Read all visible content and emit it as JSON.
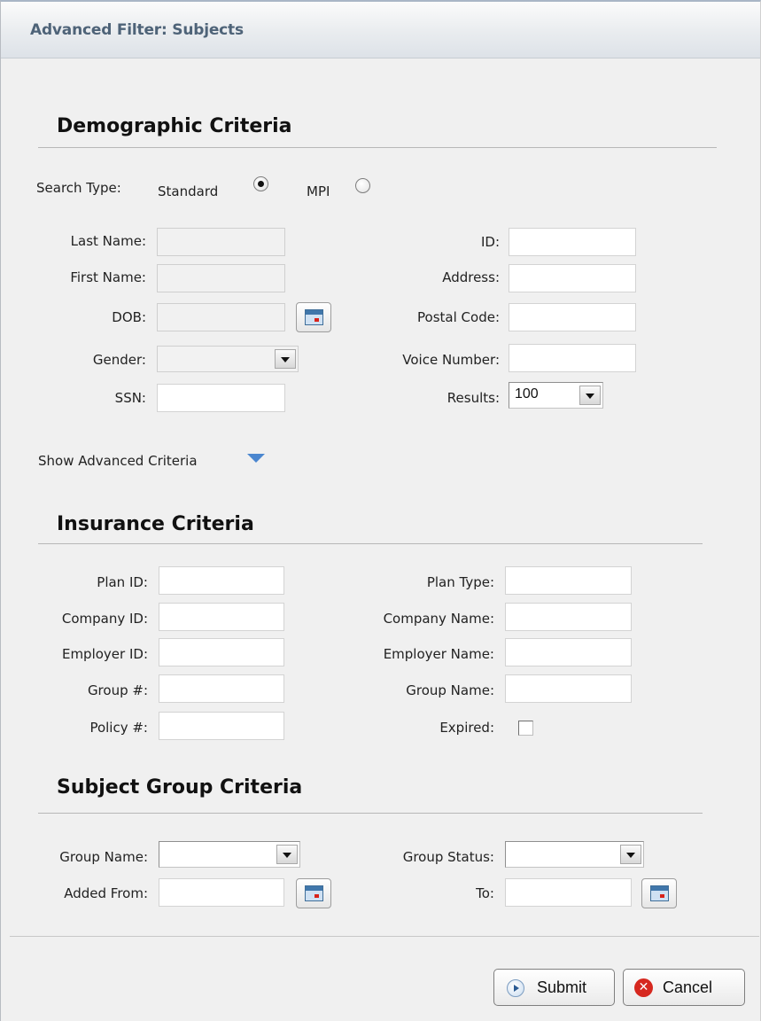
{
  "dialog": {
    "title": "Advanced Filter: Subjects"
  },
  "demographic": {
    "heading": "Demographic Criteria",
    "search_type_label": "Search Type:",
    "standard_label": "Standard",
    "mpi_label": "MPI",
    "last_name_label": "Last Name:",
    "first_name_label": "First Name:",
    "dob_label": "DOB:",
    "gender_label": "Gender:",
    "ssn_label": "SSN:",
    "id_label": "ID:",
    "address_label": "Address:",
    "postal_code_label": "Postal Code:",
    "voice_number_label": "Voice Number:",
    "results_label": "Results:",
    "results_value": "100",
    "show_advanced": "Show Advanced Criteria"
  },
  "insurance": {
    "heading": "Insurance Criteria",
    "plan_id_label": "Plan ID:",
    "company_id_label": "Company ID:",
    "employer_id_label": "Employer ID:",
    "group_num_label": "Group #:",
    "policy_num_label": "Policy #:",
    "plan_type_label": "Plan Type:",
    "company_name_label": "Company Name:",
    "employer_name_label": "Employer Name:",
    "group_name_label": "Group Name:",
    "expired_label": "Expired:"
  },
  "subject_group": {
    "heading": "Subject Group Criteria",
    "group_name_label": "Group Name:",
    "added_from_label": "Added From:",
    "group_status_label": "Group Status:",
    "to_label": "To:"
  },
  "buttons": {
    "submit": "Submit",
    "cancel": "Cancel"
  }
}
